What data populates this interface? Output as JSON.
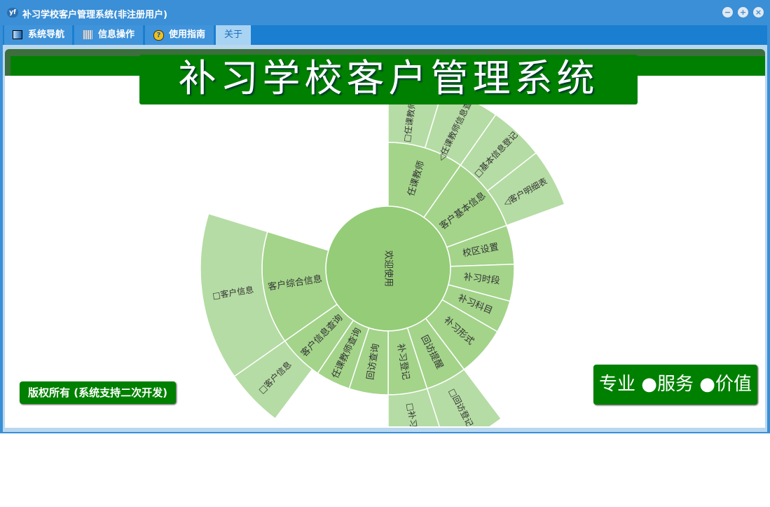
{
  "window": {
    "title": "补习学校客户管理系统(非注册用户)",
    "logo": "yf",
    "controls": [
      "minimize",
      "maximize",
      "close"
    ]
  },
  "tabs": [
    {
      "label": "系统导航",
      "icon": "monitor-icon"
    },
    {
      "label": "信息操作",
      "icon": "grid-icon"
    },
    {
      "label": "使用指南",
      "icon": "help-icon"
    },
    {
      "label": "关于",
      "active": true
    }
  ],
  "banner": "补习学校客户管理系统",
  "copyright": "版权所有 (系统支持二次开发)",
  "slogan": "专业 ●服务 ●价值",
  "colors": {
    "center": "#95cc78",
    "ring1": "#a3d48a",
    "ring2": "#b5dca4",
    "green": "#008000"
  },
  "sunburst": {
    "center": "欢迎使用",
    "ring1": [
      {
        "label": "任课教师",
        "start": 0,
        "end": 35
      },
      {
        "label": "客户基本信息",
        "start": 35,
        "end": 70
      },
      {
        "label": "校区设置",
        "start": 70,
        "end": 88
      },
      {
        "label": "补习时段",
        "start": 88,
        "end": 105
      },
      {
        "label": "补习科目",
        "start": 105,
        "end": 120
      },
      {
        "label": "补习形式",
        "start": 120,
        "end": 143
      },
      {
        "label": "回访提醒",
        "start": 143,
        "end": 162
      },
      {
        "label": "补习登记",
        "start": 162,
        "end": 180
      },
      {
        "label": "回访查询",
        "start": 180,
        "end": 198
      },
      {
        "label": "任课教师查询",
        "start": 198,
        "end": 214
      },
      {
        "label": "客户信息查询",
        "start": 214,
        "end": 235
      },
      {
        "label": "客户综合信息",
        "start": 235,
        "end": 287
      }
    ],
    "ring2": [
      {
        "label": "□任课教师信息",
        "start": 0,
        "end": 17
      },
      {
        "label": "◁任课教师信息查询",
        "start": 17,
        "end": 35
      },
      {
        "label": "□基本信息登记",
        "start": 35,
        "end": 52
      },
      {
        "label": "◁客户明细表",
        "start": 52,
        "end": 70
      },
      {
        "label": "□回访登记",
        "start": 143,
        "end": 162
      },
      {
        "label": "□补习登记",
        "start": 162,
        "end": 180
      },
      {
        "label": "□客户信息",
        "start": 217,
        "end": 235
      },
      {
        "label": "□客户信息",
        "start": 235,
        "end": 287
      }
    ]
  }
}
